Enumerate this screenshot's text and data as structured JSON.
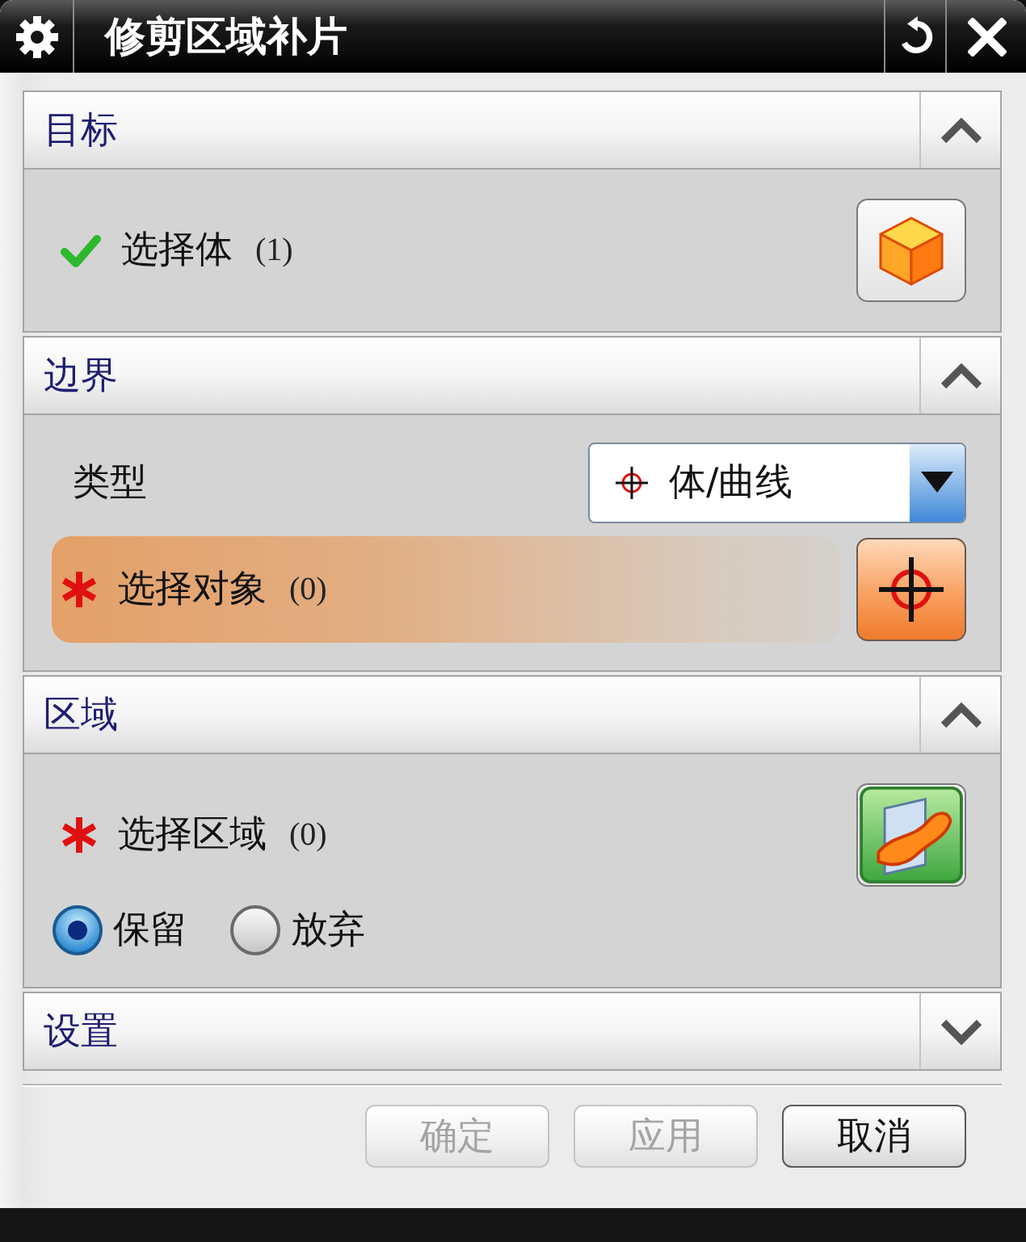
{
  "window": {
    "title": "修剪区域补片"
  },
  "sections": [
    {
      "title": "目标",
      "expanded": true,
      "rows": [
        {
          "kind": "selection",
          "label": "选择体",
          "count": "(1)",
          "complete": true,
          "active": false
        }
      ]
    },
    {
      "title": "边界",
      "expanded": true,
      "rows": [
        {
          "kind": "dropdown",
          "label": "类型",
          "value": "体/曲线"
        },
        {
          "kind": "selection",
          "label": "选择对象",
          "count": "(0)",
          "complete": false,
          "active": true
        }
      ]
    },
    {
      "title": "区域",
      "expanded": true,
      "rows": [
        {
          "kind": "selection",
          "label": "选择区域",
          "count": "(0)",
          "complete": false,
          "active": false
        },
        {
          "kind": "radio_group",
          "options": [
            {
              "label": "保留",
              "selected": true
            },
            {
              "label": "放弃",
              "selected": false
            }
          ]
        }
      ]
    },
    {
      "title": "设置",
      "expanded": false
    }
  ],
  "buttons": [
    {
      "label": "确定",
      "disabled": true
    },
    {
      "label": "应用",
      "disabled": true
    },
    {
      "label": "取消",
      "disabled": false
    }
  ]
}
